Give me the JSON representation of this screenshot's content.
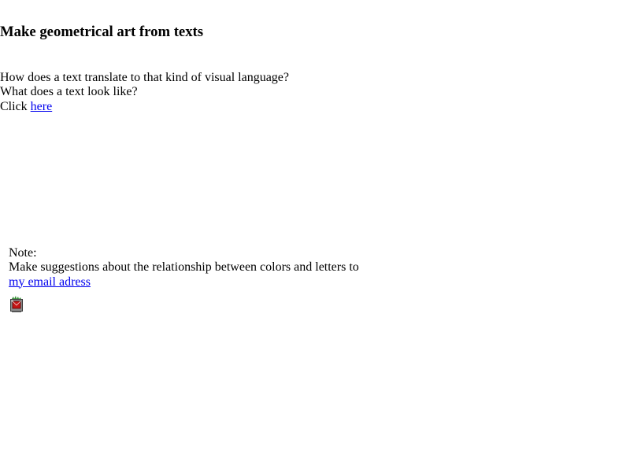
{
  "header": {
    "title": "Make geometrical art from texts"
  },
  "intro": {
    "line1": "How does a text translate to that kind of visual language?",
    "line2": "What does a text look like?",
    "click_prefix": "Click ",
    "here_link": "here"
  },
  "note": {
    "label": "Note:",
    "text": "Make suggestions about the relationship between colors and letters to",
    "email_link": "my email adress"
  },
  "icons": {
    "mailbox": "mailbox-icon"
  },
  "colors": {
    "link": "#0000ee",
    "text": "#000000",
    "background": "#ffffff"
  }
}
